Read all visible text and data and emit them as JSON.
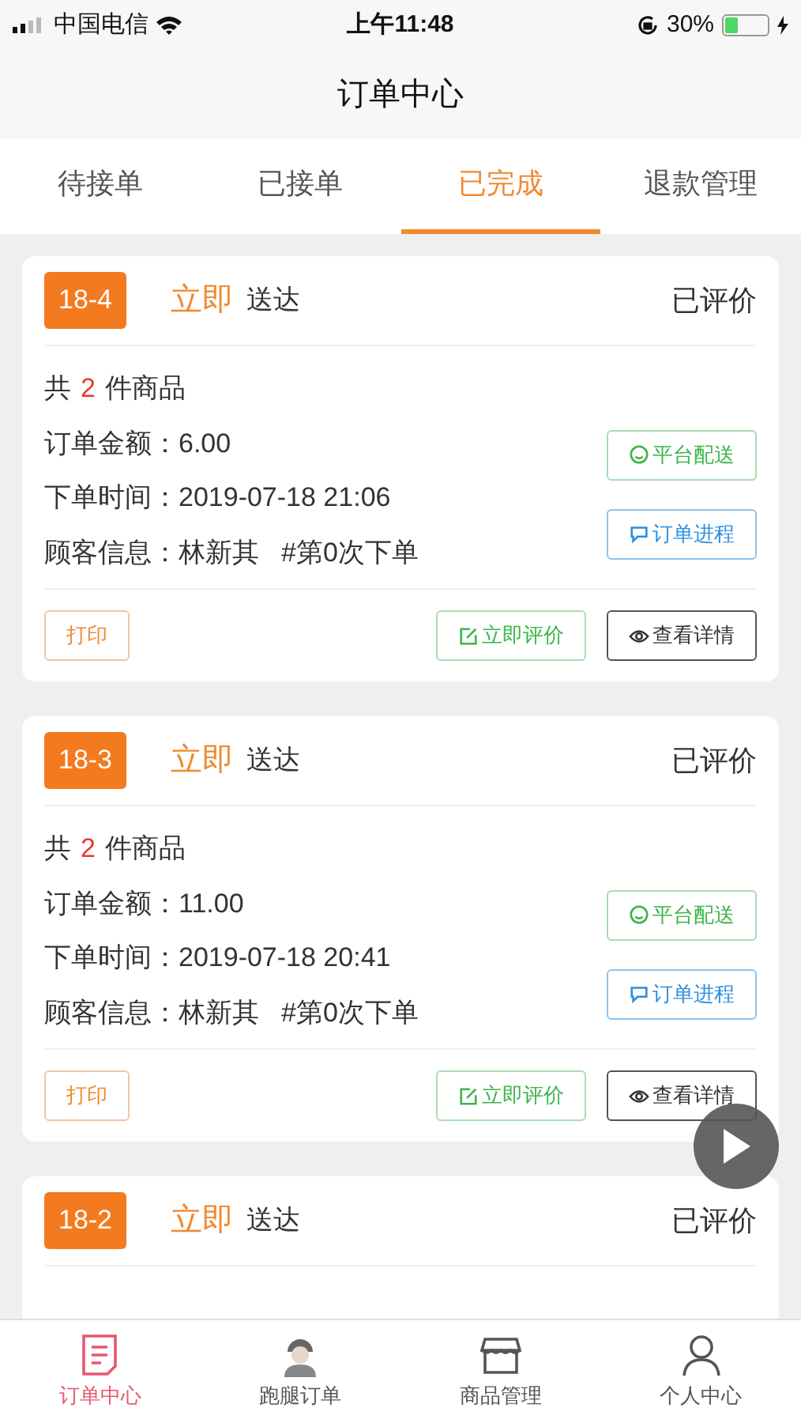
{
  "status_bar": {
    "carrier": "中国电信",
    "time": "上午11:48",
    "battery": "30%",
    "battery_icon": {
      "level": 0.3
    }
  },
  "header": {
    "title": "订单中心"
  },
  "tabs": [
    {
      "label": "待接单",
      "selected": false
    },
    {
      "label": "已接单",
      "selected": false
    },
    {
      "label": "已完成",
      "selected": true
    },
    {
      "label": "退款管理",
      "selected": false
    }
  ],
  "orders": [
    {
      "code": "18-4",
      "timing": "立即",
      "mode": "送达",
      "review_status": "已评价",
      "count_prefix": "共",
      "count": "2",
      "count_suffix": "件商品",
      "amount_label": "订单金额：",
      "amount": "6.00",
      "time_label": "下单时间：",
      "time": "2019-07-18 21:06",
      "customer_label": "顾客信息：",
      "customer": "林新其",
      "order_no": "#第0次下单",
      "side_buttons": [
        {
          "kind": "delivery",
          "label": "平台配送"
        },
        {
          "kind": "progress",
          "label": "订单进程"
        }
      ],
      "print": "打印",
      "actions": [
        {
          "kind": "review",
          "label": "立即评价"
        },
        {
          "kind": "details",
          "label": "查看详情"
        }
      ]
    },
    {
      "code": "18-3",
      "timing": "立即",
      "mode": "送达",
      "review_status": "已评价",
      "count_prefix": "共",
      "count": "2",
      "count_suffix": "件商品",
      "amount_label": "订单金额：",
      "amount": "11.00",
      "time_label": "下单时间：",
      "time": "2019-07-18 20:41",
      "customer_label": "顾客信息：",
      "customer": "林新其",
      "order_no": "#第0次下单",
      "side_buttons": [
        {
          "kind": "delivery",
          "label": "平台配送"
        },
        {
          "kind": "progress",
          "label": "订单进程"
        }
      ],
      "print": "打印",
      "actions": [
        {
          "kind": "review",
          "label": "立即评价"
        },
        {
          "kind": "details",
          "label": "查看详情"
        }
      ]
    },
    {
      "code": "18-2",
      "timing": "立即",
      "mode": "送达",
      "review_status": "已评价"
    }
  ],
  "bottom_nav": [
    {
      "kind": "orders",
      "label": "订单中心",
      "selected": true
    },
    {
      "kind": "errands",
      "label": "跑腿订单",
      "selected": false
    },
    {
      "kind": "goods",
      "label": "商品管理",
      "selected": false
    },
    {
      "kind": "profile",
      "label": "个人中心",
      "selected": false
    }
  ]
}
